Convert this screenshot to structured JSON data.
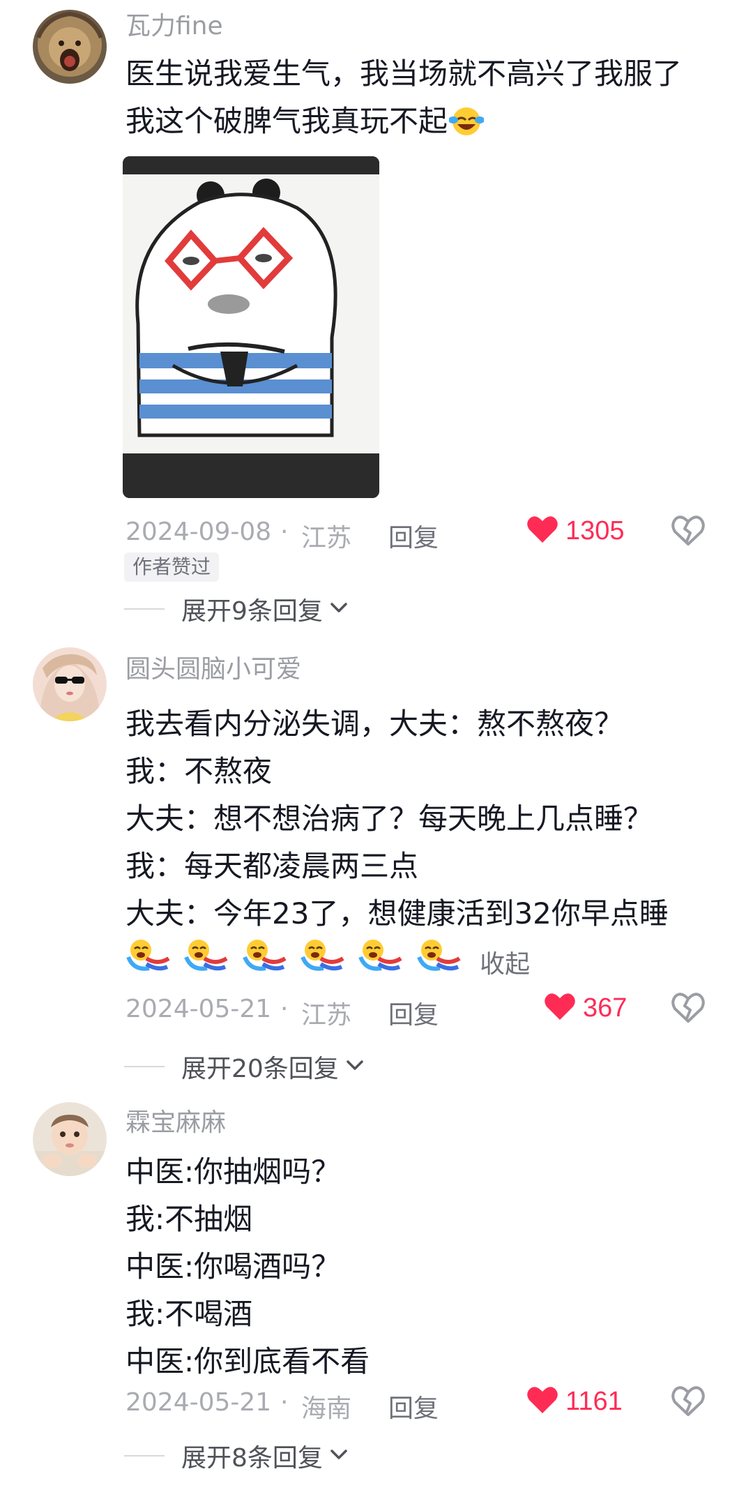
{
  "comments": [
    {
      "username": "瓦力fine",
      "lines": [
        "医生说我爱生气，我当场就不高兴了我服了",
        "我这个破脾气我真玩不起"
      ],
      "inline_emoji": "laughing-crying-emoji",
      "date": "2024-09-08",
      "dot": "·",
      "location": "江苏",
      "reply_label": "回复",
      "likes": "1305",
      "author_badge": "作者赞过",
      "expand_label": "展开9条回复"
    },
    {
      "username": "圆头圆脑小可爱",
      "lines": [
        "我去看内分泌失调，大夫：熬不熬夜？",
        "我：不熬夜",
        "大夫：想不想治病了？每天晚上几点睡？",
        "我：每天都凌晨两三点",
        "大夫：今年23了，想健康活到32你早点睡"
      ],
      "collapse_label": "收起",
      "date": "2024-05-21",
      "dot": "·",
      "location": "江苏",
      "reply_label": "回复",
      "likes": "367",
      "expand_label": "展开20条回复"
    },
    {
      "username": "霖宝麻麻",
      "lines": [
        "中医:你抽烟吗？",
        "我:不抽烟",
        "中医:你喝酒吗？",
        "我:不喝酒",
        "中医:你到底看不看"
      ],
      "date": "2024-05-21",
      "dot": "·",
      "location": "海南",
      "reply_label": "回复",
      "likes": "1161",
      "expand_label": "展开8条回复"
    }
  ],
  "colors": {
    "like_red": "#fe2c55",
    "meta_gray": "#a9abb1",
    "username_gray": "#9b9da3"
  }
}
